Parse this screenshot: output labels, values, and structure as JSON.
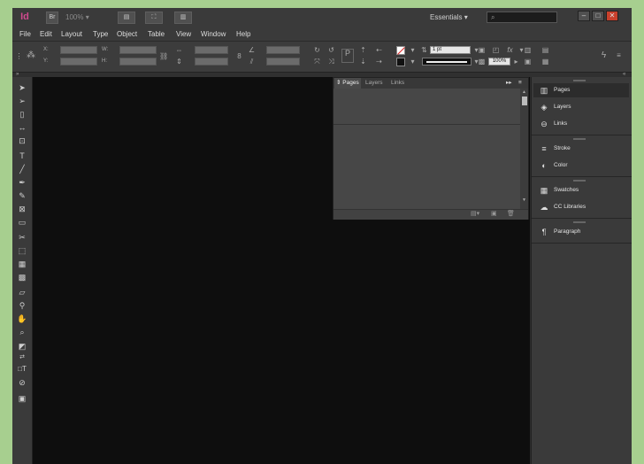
{
  "app": {
    "logo": "Id",
    "bridge_btn": "Br",
    "zoom": "100%",
    "workspace": "Essentials",
    "search_icon": "⌕"
  },
  "menu": [
    "File",
    "Edit",
    "Layout",
    "Type",
    "Object",
    "Table",
    "View",
    "Window",
    "Help"
  ],
  "control": {
    "x_label": "X:",
    "y_label": "Y:",
    "w_label": "W:",
    "h_label": "H:",
    "stroke_weight": "1 pt",
    "opacity": "100%"
  },
  "pages_panel": {
    "tabs": [
      "Pages",
      "Layers",
      "Links"
    ]
  },
  "dock": {
    "group1": [
      {
        "label": "Pages",
        "icon": "pages-icon"
      },
      {
        "label": "Layers",
        "icon": "layers-icon"
      },
      {
        "label": "Links",
        "icon": "links-icon"
      }
    ],
    "group2": [
      {
        "label": "Stroke",
        "icon": "stroke-icon"
      },
      {
        "label": "Color",
        "icon": "color-icon"
      }
    ],
    "group3": [
      {
        "label": "Swatches",
        "icon": "swatches-icon"
      },
      {
        "label": "CC Libraries",
        "icon": "cc-libraries-icon"
      }
    ],
    "group4": [
      {
        "label": "Paragraph",
        "icon": "paragraph-icon"
      }
    ]
  }
}
